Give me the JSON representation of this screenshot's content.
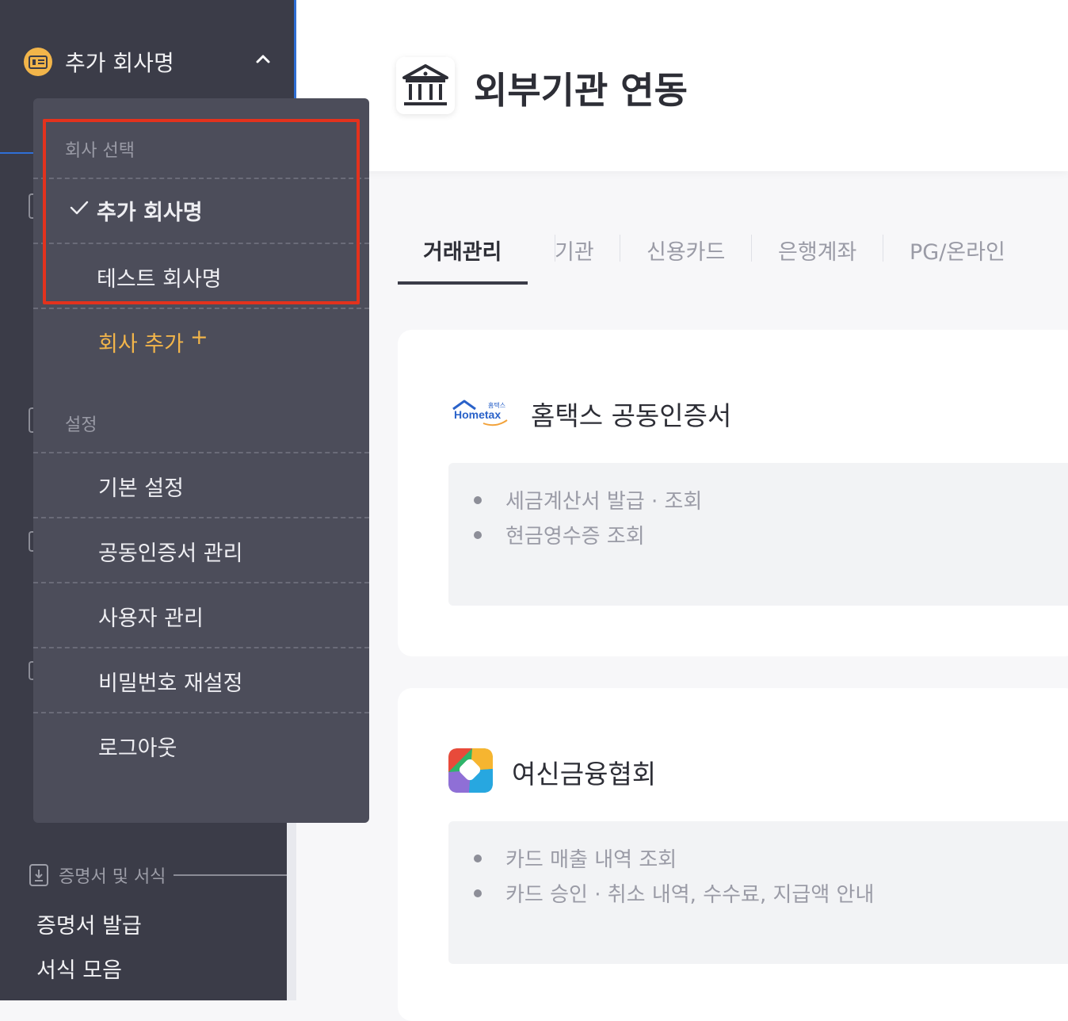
{
  "sidebar": {
    "company_name": "추가 회사명",
    "certificate_section_label": "증명서 및 서식",
    "certificate_links": [
      "증명서 발급",
      "서식 모음"
    ]
  },
  "dropdown": {
    "company_select_header": "회사 선택",
    "companies": [
      {
        "name": "추가 회사명",
        "selected": true
      },
      {
        "name": "테스트 회사명",
        "selected": false
      }
    ],
    "add_company": "회사 추가",
    "add_icon": "+",
    "settings_header": "설정",
    "settings_items": [
      "기본 설정",
      "공동인증서 관리",
      "사용자 관리",
      "비밀번호 재설정",
      "로그아웃"
    ]
  },
  "main": {
    "title": "외부기관 연동",
    "tabs": [
      "거래관리",
      "기관",
      "신용카드",
      "은행계좌",
      "PG/온라인"
    ],
    "active_tab": "거래관리",
    "cards": [
      {
        "logo_text": "Hometax",
        "logo_small": "홈택스",
        "title": "홈택스 공동인증서",
        "features": [
          "세금계산서 발급 · 조회",
          "현금영수증 조회"
        ]
      },
      {
        "title": "여신금융협회",
        "features": [
          "카드 매출 내역 조회",
          "카드 승인 · 취소 내역, 수수료, 지급액 안내"
        ]
      }
    ]
  },
  "colors": {
    "sidebar_bg": "#3b3c48",
    "dropdown_bg": "#4c4d5a",
    "accent_orange": "#f2b54a",
    "highlight_red": "#e3321d"
  },
  "icons": [
    "company-icon",
    "chevron-up-icon",
    "check-icon",
    "plus-icon",
    "bank-icon",
    "download-icon",
    "hometax-logo",
    "crefia-logo"
  ]
}
